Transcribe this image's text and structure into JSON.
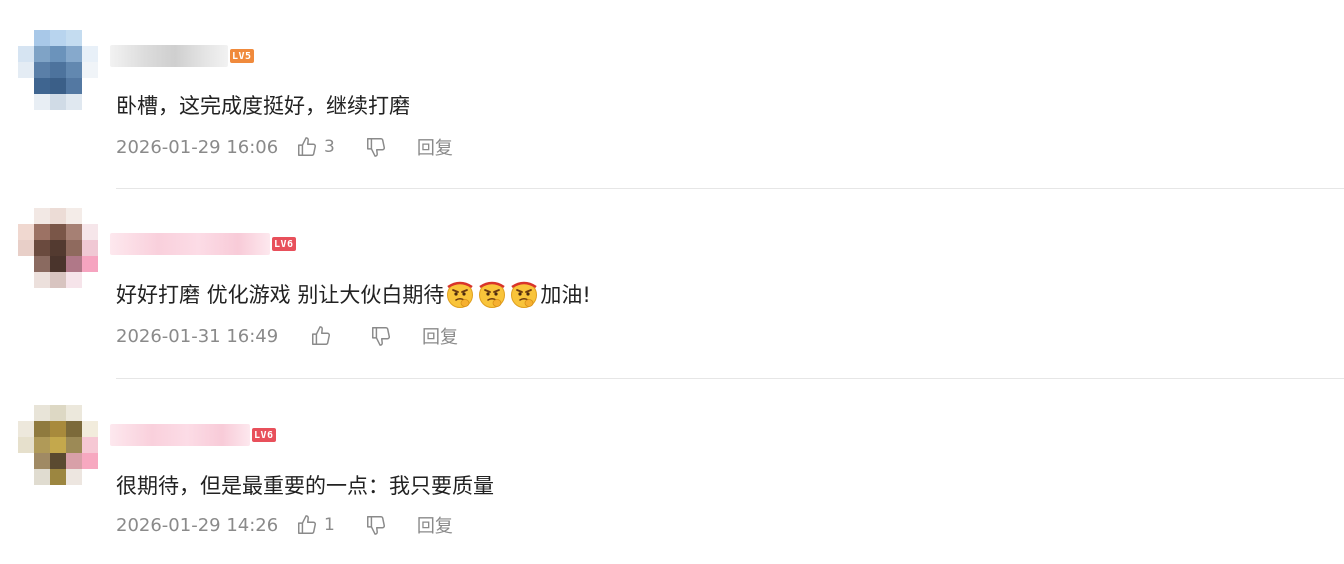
{
  "comments": [
    {
      "level": "LV5",
      "level_color": "#f08a3c",
      "text": "卧槽，这完成度挺好，继续打磨",
      "time": "2026-01-29 16:06",
      "likes": "3",
      "reply_label": "回复"
    },
    {
      "level": "LV6",
      "level_color": "#e8505b",
      "text": "好好打磨 优化游戏 别让大伙白期待",
      "text_after_emoji": "加油!",
      "emoji_name": "thinking-face-emoji",
      "time": "2026-01-31 16:49",
      "likes": "",
      "reply_label": "回复"
    },
    {
      "level": "LV6",
      "level_color": "#e8505b",
      "text": "很期待，但是最重要的一点：我只要质量",
      "time": "2026-01-29 14:26",
      "likes": "1",
      "reply_label": "回复"
    }
  ],
  "icons": {
    "like": "thumbs-up-icon",
    "dislike": "thumbs-down-icon"
  },
  "colors": {
    "meta_text": "#8a8a8a",
    "body_text": "#222222",
    "divider": "#e6e6e6"
  }
}
